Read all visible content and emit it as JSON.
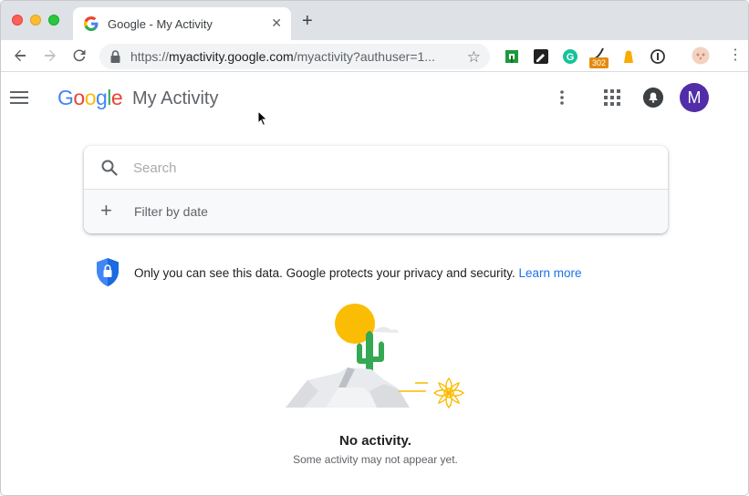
{
  "browser": {
    "tab_title": "Google - My Activity",
    "tab_close": "✕",
    "new_tab": "+",
    "url_prefix": "https://",
    "url_host": "myactivity.google.com",
    "url_path": "/myactivity?authuser=1...",
    "extension_badge": "302"
  },
  "header": {
    "logo_letters": [
      "G",
      "o",
      "o",
      "g",
      "l",
      "e"
    ],
    "product_name": "My Activity",
    "avatar_letter": "M"
  },
  "search": {
    "placeholder": "Search",
    "value": "",
    "filter_label": "Filter by date"
  },
  "privacy": {
    "message": "Only you can see this data. Google protects your privacy and security.",
    "link_label": "Learn more"
  },
  "empty_state": {
    "title": "No activity.",
    "subtitle": "Some activity may not appear yet."
  },
  "colors": {
    "brand_blue": "#4285f4",
    "brand_red": "#ea4335",
    "brand_yellow": "#fbbc05",
    "brand_green": "#34a853",
    "link_blue": "#1a73e8",
    "avatar_purple": "#512da8"
  },
  "icons": {
    "nav": [
      "back-arrow-icon",
      "forward-arrow-icon",
      "reload-icon"
    ],
    "omnibox": [
      "lock-icon",
      "star-icon"
    ],
    "extensions": [
      "green-extension-icon",
      "pen-extension-icon",
      "grammarly-icon",
      "redirect-path-icon",
      "yellow-extension-icon",
      "info-extension-icon",
      "profile-avatar-icon"
    ],
    "header": [
      "menu-icon",
      "more-vert-icon",
      "apps-grid-icon",
      "notifications-icon"
    ]
  }
}
